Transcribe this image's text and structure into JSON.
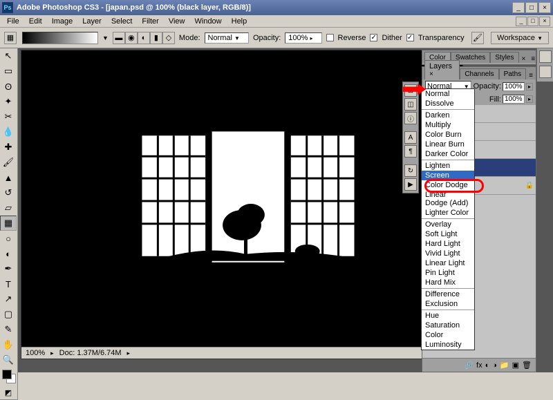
{
  "titlebar": {
    "app": "Adobe Photoshop CS3",
    "doc": "[japan.psd @ 100% (black layer, RGB/8)]",
    "ps": "Ps",
    "min": "_",
    "max": "□",
    "close": "×"
  },
  "menu": {
    "file": "File",
    "edit": "Edit",
    "image": "Image",
    "layer": "Layer",
    "select": "Select",
    "filter": "Filter",
    "view": "View",
    "window": "Window",
    "help": "Help"
  },
  "opt": {
    "mode_lbl": "Mode:",
    "mode_val": "Normal",
    "opacity_lbl": "Opacity:",
    "opacity_val": "100%",
    "reverse": "Reverse",
    "dither": "Dither",
    "transparency": "Transparency",
    "workspace": "Workspace"
  },
  "status": {
    "zoom": "100%",
    "doc": "Doc: 1.37M/6.74M"
  },
  "panels": {
    "color": {
      "tabs": [
        "Color",
        "Swatches",
        "Styles"
      ]
    },
    "layers": {
      "tabs": [
        "Layers",
        "Channels",
        "Paths"
      ],
      "blend_val": "Normal",
      "opacity_lbl": "Opacity:",
      "opacity_val": "100%",
      "fill_lbl": "Fill:",
      "fill_val": "100%"
    }
  },
  "blend_modes": {
    "g1": [
      "Normal",
      "Dissolve"
    ],
    "g2": [
      "Darken",
      "Multiply",
      "Color Burn",
      "Linear Burn",
      "Darker Color"
    ],
    "g3": [
      "Lighten",
      "Screen",
      "Color Dodge",
      "Linear Dodge (Add)",
      "Lighter Color"
    ],
    "g4": [
      "Overlay",
      "Soft Light",
      "Hard Light",
      "Vivid Light",
      "Linear Light",
      "Pin Light",
      "Hard Mix"
    ],
    "g5": [
      "Difference",
      "Exclusion"
    ],
    "g6": [
      "Hue",
      "Saturation",
      "Color",
      "Luminosity"
    ]
  }
}
